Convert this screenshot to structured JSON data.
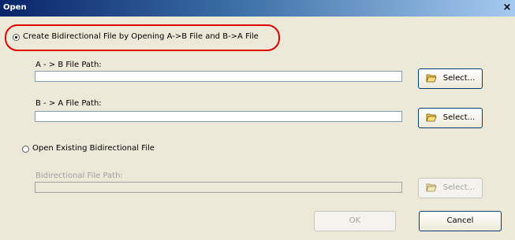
{
  "window": {
    "title": "Open",
    "close_symbol": "×"
  },
  "option_create": {
    "label": "Create Bidirectional File by Opening A->B File and B->A File",
    "selected": true,
    "ab_label": "A - > B File Path:",
    "ab_value": "",
    "ba_label": "B - > A File Path:",
    "ba_value": "",
    "select_label": "Select..."
  },
  "option_open": {
    "label": "Open Existing Bidirectional File",
    "selected": false,
    "path_label": "Bidirectional File Path:",
    "path_value": "",
    "select_label": "Select..."
  },
  "footer": {
    "ok_label": "OK",
    "cancel_label": "Cancel"
  },
  "colors": {
    "highlight": "#e00000",
    "title_bar": "#0a246a"
  },
  "icons": {
    "select": "folder-open-icon"
  }
}
